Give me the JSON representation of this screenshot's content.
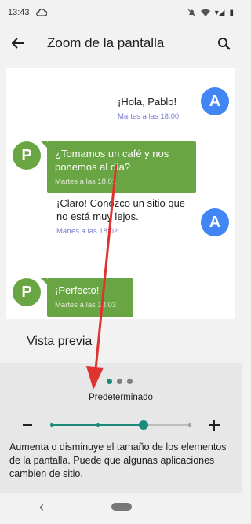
{
  "status_bar": {
    "time": "13:43",
    "signal": "▾◢",
    "battery": "▮"
  },
  "app_bar": {
    "title": "Zoom de la pantalla"
  },
  "preview": {
    "messages": [
      {
        "sender": "A",
        "text": "¡Hola, Pablo!",
        "time": "Martes a las 18:00"
      },
      {
        "sender": "P",
        "text": "¿Tomamos un café y nos ponemos al día?",
        "time": "Martes a las 18:01"
      },
      {
        "sender": "A",
        "text": "¡Claro! Conozco un sitio que no está muy lejos.",
        "time": "Martes a las 18:02"
      },
      {
        "sender": "P",
        "text": "¡Perfecto!",
        "time": "Martes a las 18:03"
      }
    ]
  },
  "vista_previa_label": "Vista previa",
  "zoom": {
    "level_label": "Predeterminado",
    "levels": 4,
    "selected_level": 3
  },
  "pager": {
    "pages": 3,
    "active": 0
  },
  "description": "Aumenta o disminuye el tamaño de los elementos de la pantalla. Puede que algunas aplicaciones cambien de sitio.",
  "colors": {
    "accent": "#1e8a7a",
    "avatar_a": "#4285f4",
    "avatar_p": "#6aa543",
    "annotation_arrow": "#e0322e"
  }
}
